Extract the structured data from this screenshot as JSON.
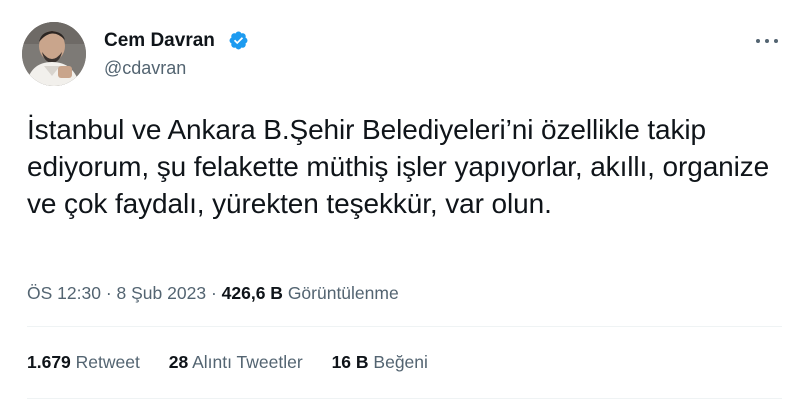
{
  "author": {
    "display_name": "Cem Davran",
    "handle": "@cdavran",
    "verified_color": "#1d9bf0"
  },
  "tweet": {
    "text": "İstanbul ve Ankara B.Şehir Belediyeleri’ni özellikle takip ediyorum, şu felakette müthiş işler yapıyorlar, akıllı, organize ve çok faydalı, yürekten teşekkür, var olun."
  },
  "meta": {
    "time": "ÖS 12:30",
    "separator": "·",
    "date": "8 Şub 2023",
    "views_count": "426,6 B",
    "views_label": "Görüntülenme"
  },
  "stats": {
    "retweets_count": "1.679",
    "retweets_label": "Retweet",
    "quotes_count": "28",
    "quotes_label": "Alıntı Tweetler",
    "likes_count": "16 B",
    "likes_label": "Beğeni"
  },
  "icons": {
    "verified": "verified-badge-icon",
    "more": "more-options-icon"
  }
}
